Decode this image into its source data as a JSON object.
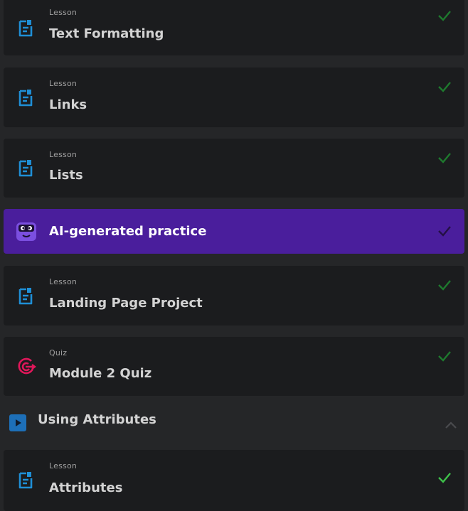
{
  "items": [
    {
      "type": "Lesson",
      "title": "Text Formatting",
      "icon": "lesson-doc-icon",
      "status": "completed"
    },
    {
      "type": "Lesson",
      "title": "Links",
      "icon": "lesson-doc-icon",
      "status": "completed"
    },
    {
      "type": "Lesson",
      "title": "Lists",
      "icon": "lesson-doc-icon",
      "status": "completed"
    },
    {
      "type": "",
      "title": "AI-generated practice",
      "icon": "ai-robot-icon",
      "status": "completed"
    },
    {
      "type": "Lesson",
      "title": "Landing Page Project",
      "icon": "lesson-doc-icon",
      "status": "completed"
    },
    {
      "type": "Quiz",
      "title": "Module 2 Quiz",
      "icon": "quiz-target-icon",
      "status": "completed"
    }
  ],
  "section": {
    "title": "Using Attributes",
    "icon": "video-play-icon",
    "expanded": true
  },
  "section_items": [
    {
      "type": "Lesson",
      "title": "Attributes",
      "icon": "lesson-doc-icon",
      "status": "completed"
    }
  ],
  "colors": {
    "lesson_icon": "#1f8fd6",
    "quiz_icon": "#e0175a",
    "check_dim": "#1e7a2e",
    "check_bright": "#3ec24a",
    "highlight_bg": "#4a1e9c"
  }
}
